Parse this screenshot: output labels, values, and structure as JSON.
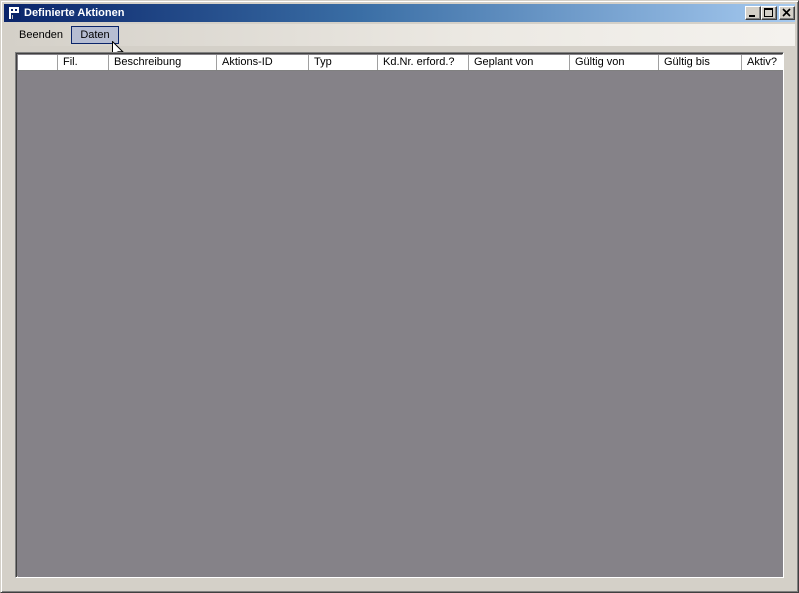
{
  "window": {
    "title": "Definierte Aktionen"
  },
  "icons": {
    "app": "app-icon",
    "minimize": "minimize-icon",
    "maximize": "maximize-icon",
    "close": "close-icon",
    "cursor": "mouse-pointer-icon"
  },
  "menu": {
    "items": [
      {
        "label": "Beenden"
      },
      {
        "label": "Daten"
      }
    ]
  },
  "grid": {
    "columns": [
      "",
      "Fil.",
      "Beschreibung",
      "Aktions-ID",
      "Typ",
      "Kd.Nr. erford.?",
      "Geplant von",
      "Gültig von",
      "Gültig bis",
      "Aktiv?"
    ],
    "rows": []
  },
  "colors": {
    "titlebar_start": "#0a246a",
    "titlebar_end": "#a6caf0",
    "grid_background": "#858288",
    "menu_highlight": "#b6bdd2",
    "window_face": "#d4d0c8"
  }
}
